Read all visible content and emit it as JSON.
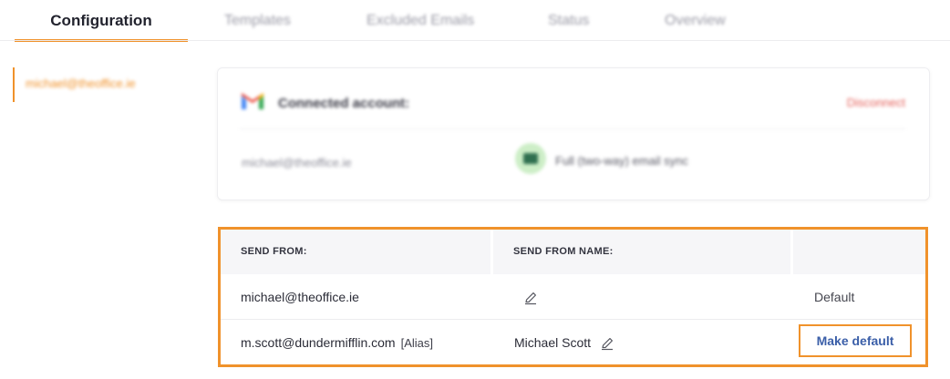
{
  "tabs": {
    "configuration": "Configuration",
    "templates": "Templates",
    "excluded_emails": "Excluded Emails",
    "status": "Status",
    "overview": "Overview"
  },
  "sidebar": {
    "account": "michael@theoffice.ie"
  },
  "connected_account": {
    "title": "Connected account:",
    "disconnect": "Disconnect",
    "email": "michael@theoffice.ie",
    "sync_mode": "Full (two-way) email sync",
    "icons": [
      "gmail-icon",
      "sync-icon"
    ]
  },
  "send_from": {
    "headers": {
      "send_from": "SEND FROM:",
      "send_from_name": "SEND FROM NAME:",
      "action": ""
    },
    "rows": [
      {
        "email": "michael@theoffice.ie",
        "alias_tag": "",
        "name": "",
        "status": "Default"
      },
      {
        "email": "m.scott@dundermifflin.com",
        "alias_tag": "[Alias]",
        "name": "Michael Scott",
        "action": "Make default"
      }
    ]
  },
  "colors": {
    "accent": "#f0922b",
    "link": "#3a5ea8",
    "danger": "#e4605a"
  }
}
